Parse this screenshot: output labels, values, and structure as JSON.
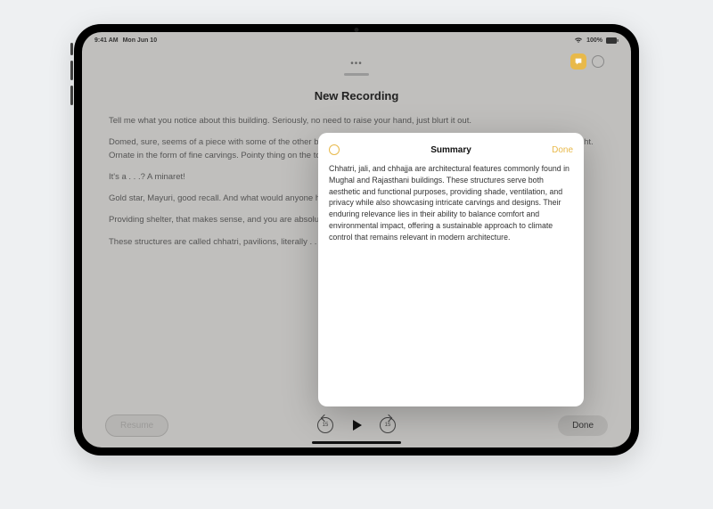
{
  "status": {
    "time": "9:41 AM",
    "date": "Mon Jun 10",
    "battery_pct": "100%"
  },
  "app": {
    "recording_title": "New Recording"
  },
  "transcript": {
    "p1": "Tell me what you notice about this building. Seriously, no need to raise your hand, just blurt it out.",
    "p2": "Domed, sure, seems of a piece with some of the other buildings we've looked at, right? A freestanding canopy, that's exactly right. Ornate in the form of fine carvings. Pointy thing on the top, OK, anyone know what those are called?",
    "p3": "It's a . . .? A minaret!",
    "p4": "Gold star, Mayuri, good recall. And what would anyone here imagine the purpose of this structure is?",
    "p5": "Providing shelter, that makes sense, and you are absolutely correct.",
    "p6": "These structures are called chhatri, pavilions, literally . . ."
  },
  "playback": {
    "skip_seconds": "15",
    "left_label": "Resume",
    "done_label": "Done"
  },
  "modal": {
    "title": "Summary",
    "done_label": "Done",
    "body": "Chhatri, jali, and chhajja are architectural features commonly found in Mughal and Rajasthani buildings. These structures serve both aesthetic and functional purposes, providing shade, ventilation, and privacy while also showcasing intricate carvings and designs. Their enduring relevance lies in their ability to balance comfort and environmental impact, offering a sustainable approach to climate control that remains relevant in modern architecture."
  }
}
